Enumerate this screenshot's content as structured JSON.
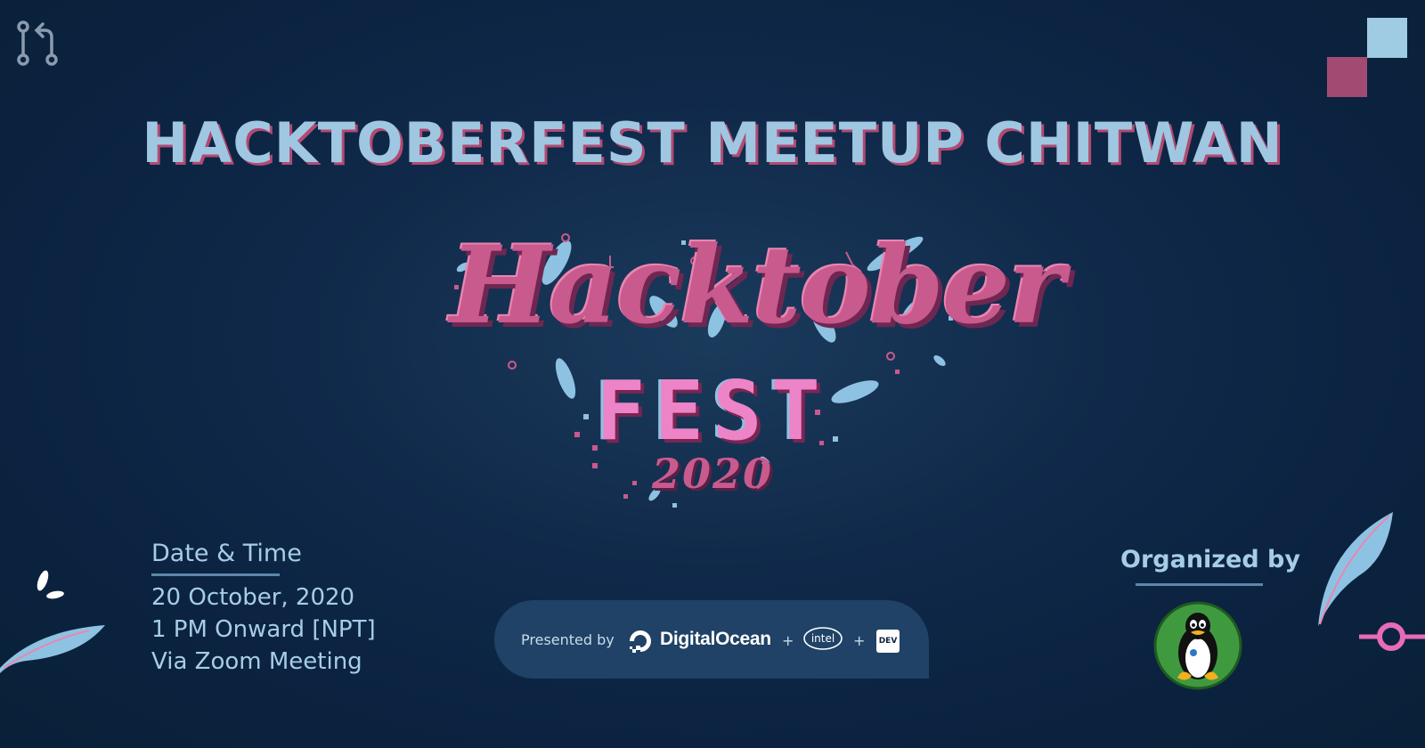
{
  "event": {
    "title": "HACKTOBERFEST MEETUP CHITWAN"
  },
  "logo": {
    "word_1": "Hacktober",
    "word_2": "FEST",
    "year": "2020"
  },
  "schedule": {
    "heading": "Date & Time",
    "date": "20 October, 2020",
    "time": "1 PM Onward [NPT]",
    "venue": "Via Zoom Meeting"
  },
  "sponsors": {
    "label": "Presented by",
    "primary": "DigitalOcean",
    "separator": "+",
    "secondary": "intel",
    "tertiary": "DEV"
  },
  "organizer": {
    "heading": "Organized by"
  },
  "colors": {
    "background": "#0b2340",
    "title_blue": "#9fc7e2",
    "accent_pink": "#c95a8d",
    "square_light": "#9fcbe3",
    "square_dark": "#a34a72",
    "presented_bar": "#1f4266",
    "tux_green": "#3f9a3f"
  },
  "icons": {
    "top_left": "git-pull-request-icon",
    "digitalocean": "digitalocean-logo",
    "intel": "intel-logo",
    "dev": "dev-logo",
    "organizer": "linux-tux-logo"
  }
}
